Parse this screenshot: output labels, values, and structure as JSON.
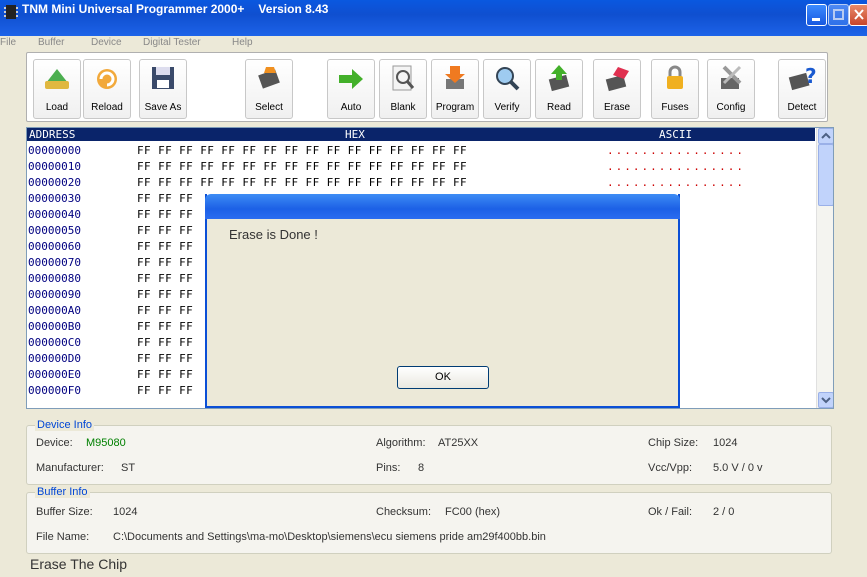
{
  "window": {
    "title": "TNM Mini Universal Programmer 2000+",
    "version": "Version 8.43"
  },
  "menu": [
    "File",
    "Buffer",
    "Device",
    "Digital Tester",
    "Help"
  ],
  "toolbar": [
    {
      "label": "Load",
      "icon": "load-icon"
    },
    {
      "label": "Reload",
      "icon": "reload-icon"
    },
    {
      "label": "Save As",
      "icon": "save-icon"
    },
    {
      "label": "Select",
      "icon": "select-chip-icon"
    },
    {
      "label": "Auto",
      "icon": "auto-arrow-icon"
    },
    {
      "label": "Blank",
      "icon": "blank-check-icon"
    },
    {
      "label": "Program",
      "icon": "program-icon"
    },
    {
      "label": "Verify",
      "icon": "verify-icon"
    },
    {
      "label": "Read",
      "icon": "read-icon"
    },
    {
      "label": "Erase",
      "icon": "erase-icon"
    },
    {
      "label": "Fuses",
      "icon": "lock-icon"
    },
    {
      "label": "Config",
      "icon": "config-tools-icon"
    },
    {
      "label": "Detect",
      "icon": "detect-chip-icon"
    }
  ],
  "hex": {
    "headers": {
      "address": "ADDRESS",
      "hex": "HEX",
      "ascii": "ASCII"
    },
    "rows": [
      {
        "addr": "00000000",
        "bytes": "FF FF FF FF FF FF FF FF FF FF FF FF FF FF FF FF",
        "ascii": "................"
      },
      {
        "addr": "00000010",
        "bytes": "FF FF FF FF FF FF FF FF FF FF FF FF FF FF FF FF",
        "ascii": "................"
      },
      {
        "addr": "00000020",
        "bytes": "FF FF FF FF FF FF FF FF FF FF FF FF FF FF FF FF",
        "ascii": "................"
      },
      {
        "addr": "00000030",
        "bytes": "FF FF FF",
        "ascii": "......."
      },
      {
        "addr": "00000040",
        "bytes": "FF FF FF",
        "ascii": "......."
      },
      {
        "addr": "00000050",
        "bytes": "FF FF FF",
        "ascii": "......."
      },
      {
        "addr": "00000060",
        "bytes": "FF FF FF",
        "ascii": "......."
      },
      {
        "addr": "00000070",
        "bytes": "FF FF FF",
        "ascii": "......."
      },
      {
        "addr": "00000080",
        "bytes": "FF FF FF",
        "ascii": "......."
      },
      {
        "addr": "00000090",
        "bytes": "FF FF FF",
        "ascii": "......."
      },
      {
        "addr": "000000A0",
        "bytes": "FF FF FF",
        "ascii": "......."
      },
      {
        "addr": "000000B0",
        "bytes": "FF FF FF",
        "ascii": "......."
      },
      {
        "addr": "000000C0",
        "bytes": "FF FF FF",
        "ascii": "......."
      },
      {
        "addr": "000000D0",
        "bytes": "FF FF FF",
        "ascii": "......."
      },
      {
        "addr": "000000E0",
        "bytes": "FF FF FF",
        "ascii": "......."
      },
      {
        "addr": "000000F0",
        "bytes": "FF FF FF",
        "ascii": "......."
      }
    ]
  },
  "device_info": {
    "legend": "Device Info",
    "device_label": "Device:",
    "device_value": "M95080",
    "algorithm_label": "Algorithm:",
    "algorithm_value": "AT25XX",
    "chip_size_label": "Chip Size:",
    "chip_size_value": "1024",
    "manufacturer_label": "Manufacturer:",
    "manufacturer_value": "ST",
    "pins_label": "Pins:",
    "pins_value": "8",
    "vcc_label": "Vcc/Vpp:",
    "vcc_value": "5.0 V / 0 v"
  },
  "buffer_info": {
    "legend": "Buffer Info",
    "size_label": "Buffer Size:",
    "size_value": "1024",
    "checksum_label": "Checksum:",
    "checksum_value": "FC00 (hex)",
    "okfail_label": "Ok / Fail:",
    "okfail_value": "2 / 0",
    "filename_label": "File Name:",
    "filename_value": "C:\\Documents and Settings\\ma-mo\\Desktop\\siemens\\ecu siemens pride am29f400bb.bin"
  },
  "status": "Erase The Chip",
  "dialog": {
    "message": "Erase is Done !",
    "ok_label": "OK"
  }
}
